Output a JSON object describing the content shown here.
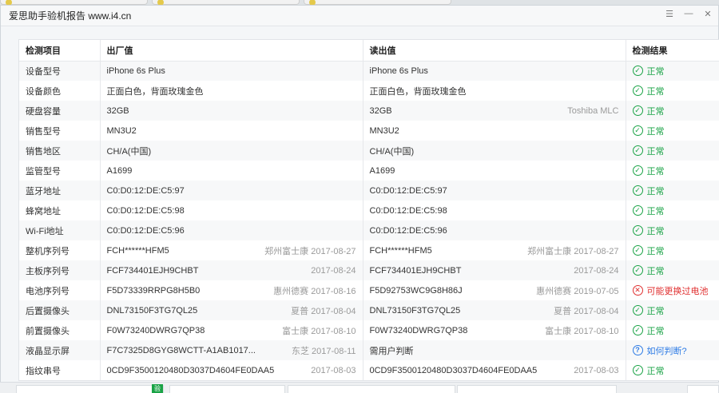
{
  "window": {
    "title": "爱思助手验机报告 www.i4.cn"
  },
  "table": {
    "headers": {
      "item": "检测项目",
      "factory": "出厂值",
      "read": "读出值",
      "result": "检测结果"
    },
    "rows": [
      {
        "label": "设备型号",
        "factory": "iPhone 6s Plus",
        "factory_note": "",
        "read": "iPhone 6s Plus",
        "read_note": "",
        "result": "正常",
        "status": "ok"
      },
      {
        "label": "设备颜色",
        "factory": "正面白色，背面玫瑰金色",
        "factory_note": "",
        "read": "正面白色，背面玫瑰金色",
        "read_note": "",
        "result": "正常",
        "status": "ok"
      },
      {
        "label": "硬盘容量",
        "factory": "32GB",
        "factory_note": "",
        "read": "32GB",
        "read_note": "Toshiba MLC",
        "result": "正常",
        "status": "ok"
      },
      {
        "label": "销售型号",
        "factory": "MN3U2",
        "factory_note": "",
        "read": "MN3U2",
        "read_note": "",
        "result": "正常",
        "status": "ok"
      },
      {
        "label": "销售地区",
        "factory": "CH/A(中国)",
        "factory_note": "",
        "read": "CH/A(中国)",
        "read_note": "",
        "result": "正常",
        "status": "ok"
      },
      {
        "label": "监管型号",
        "factory": "A1699",
        "factory_note": "",
        "read": "A1699",
        "read_note": "",
        "result": "正常",
        "status": "ok"
      },
      {
        "label": "蓝牙地址",
        "factory": "C0:D0:12:DE:C5:97",
        "factory_note": "",
        "read": "C0:D0:12:DE:C5:97",
        "read_note": "",
        "result": "正常",
        "status": "ok"
      },
      {
        "label": "蜂窝地址",
        "factory": "C0:D0:12:DE:C5:98",
        "factory_note": "",
        "read": "C0:D0:12:DE:C5:98",
        "read_note": "",
        "result": "正常",
        "status": "ok"
      },
      {
        "label": "Wi-Fi地址",
        "factory": "C0:D0:12:DE:C5:96",
        "factory_note": "",
        "read": "C0:D0:12:DE:C5:96",
        "read_note": "",
        "result": "正常",
        "status": "ok"
      },
      {
        "label": "整机序列号",
        "factory": "FCH******HFM5",
        "factory_note": "郑州富士康 2017-08-27",
        "read": "FCH******HFM5",
        "read_note": "郑州富士康 2017-08-27",
        "result": "正常",
        "status": "ok"
      },
      {
        "label": "主板序列号",
        "factory": "FCF734401EJH9CHBT",
        "factory_note": "2017-08-24",
        "read": "FCF734401EJH9CHBT",
        "read_note": "2017-08-24",
        "result": "正常",
        "status": "ok"
      },
      {
        "label": "电池序列号",
        "factory": "F5D73339RRPG8H5B0",
        "factory_note": "惠州德赛 2017-08-16",
        "read": "F5D92753WC9G8H86J",
        "read_note": "惠州德赛 2019-07-05",
        "result": "可能更换过电池",
        "status": "warn"
      },
      {
        "label": "后置摄像头",
        "factory": "DNL73150F3TG7QL25",
        "factory_note": "夏普 2017-08-04",
        "read": "DNL73150F3TG7QL25",
        "read_note": "夏普 2017-08-04",
        "result": "正常",
        "status": "ok"
      },
      {
        "label": "前置摄像头",
        "factory": "F0W73240DWRG7QP38",
        "factory_note": "富士康 2017-08-10",
        "read": "F0W73240DWRG7QP38",
        "read_note": "富士康 2017-08-10",
        "result": "正常",
        "status": "ok"
      },
      {
        "label": "液晶显示屏",
        "factory": "F7C7325D8GYG8WCTT-A1AB1017...",
        "factory_note": "东芝 2017-08-11",
        "read": "需用户判断",
        "read_note": "",
        "result": "如何判断?",
        "status": "info"
      },
      {
        "label": "指纹串号",
        "factory": "0CD9F3500120480D3037D4604FE0DAA5",
        "factory_note": "2017-08-03",
        "read": "0CD9F3500120480D3037D4604FE0DAA5",
        "read_note": "2017-08-03",
        "result": "正常",
        "status": "ok"
      }
    ]
  },
  "bottom": {
    "badge": "验"
  },
  "colors": {
    "ok": "#1aa346",
    "warn": "#e03030",
    "info": "#2d7be5"
  },
  "icons": {
    "ok": "check-circle-icon",
    "warn": "x-circle-icon",
    "info": "question-circle-icon"
  }
}
